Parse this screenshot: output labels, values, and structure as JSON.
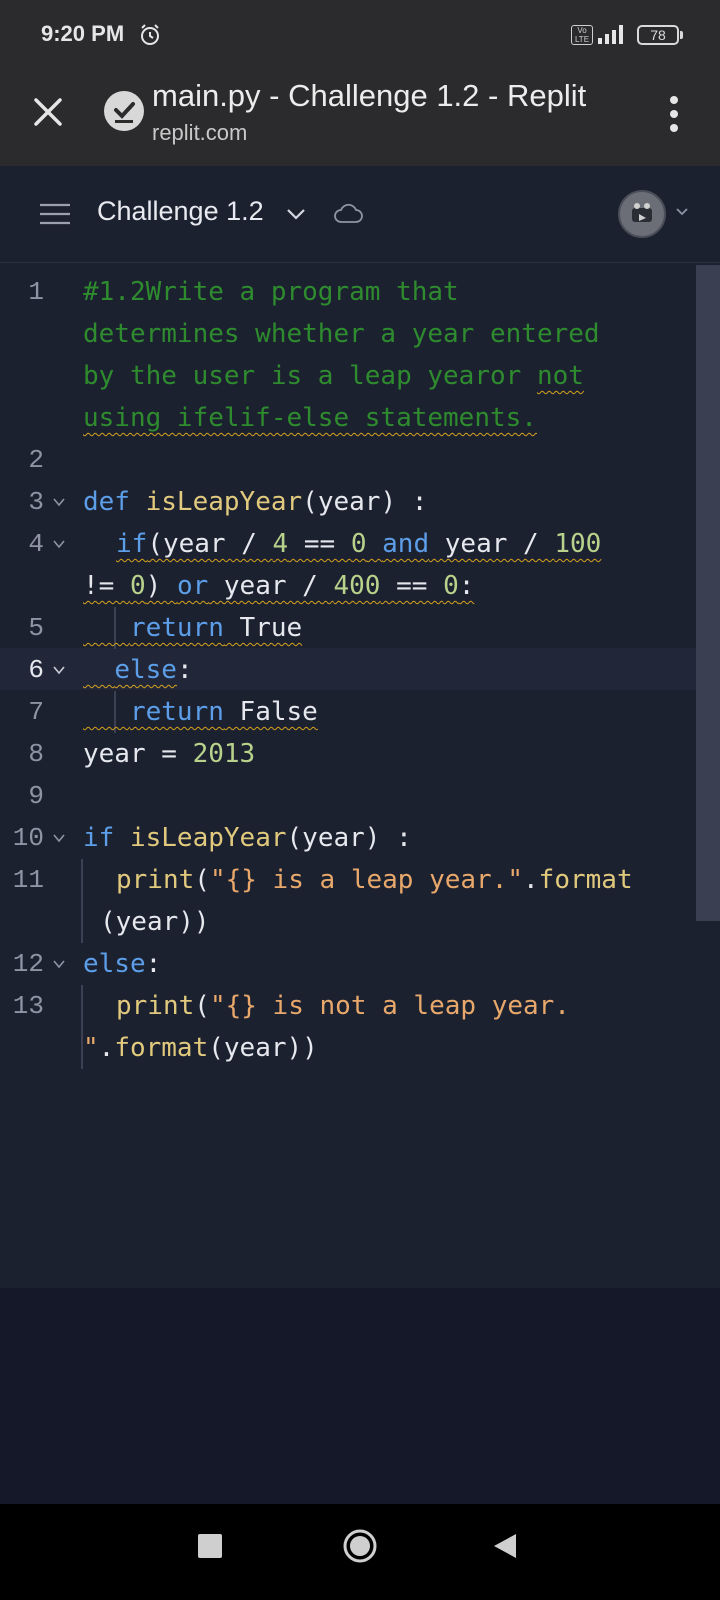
{
  "status_bar": {
    "time": "9:20 PM",
    "volte": "Vo LTE",
    "battery": "78"
  },
  "browser": {
    "tab_title": "main.py - Challenge 1.2 - Replit",
    "url": "replit.com"
  },
  "header": {
    "repl_name": "Challenge 1.2"
  },
  "editor": {
    "line_numbers": [
      "1",
      "2",
      "3",
      "4",
      "5",
      "6",
      "7",
      "8",
      "9",
      "10",
      "11",
      "12",
      "13"
    ],
    "lines": {
      "l1a": "#1.2Write a program that",
      "l1b": "determines whether a year entered",
      "l1c": "by the user is a leap yearor ",
      "l1c_sq": "not",
      "l1d": "using ifelif-else statements.",
      "l3_def": "def",
      "l3_fn": "isLeapYear",
      "l3_rest": "(year) :",
      "l4_if": "if",
      "l4_a": "(year / ",
      "l4_4": "4",
      "l4_b": " == ",
      "l4_0": "0",
      "l4_and": "and",
      "l4_c": " year / ",
      "l4_100": "100",
      "l4b_a": "!= ",
      "l4b_0": "0",
      "l4b_b": ") ",
      "l4b_or": "or",
      "l4b_c": " year / ",
      "l4b_400": "400",
      "l4b_d": " == ",
      "l4b_0b": "0",
      "l4b_e": ":",
      "l5_return": "return",
      "l5_val": " True",
      "l6_else": "else",
      "l6_colon": ":",
      "l7_return": "return",
      "l7_val": " False",
      "l8_a": "year = ",
      "l8_num": "2013",
      "l10_if": "if",
      "l10_fn": "isLeapYear",
      "l10_rest": "(year) :",
      "l11_fn": "print",
      "l11_a": "(",
      "l11_str": "\"{} is a leap year.\"",
      "l11_b": ".",
      "l11_fmt": "format",
      "l11b": "(year))",
      "l12_else": "else",
      "l12_colon": ":",
      "l13_fn": "print",
      "l13_a": "(",
      "l13_str": "\"{} is not a leap year.",
      "l13b_str": "\"",
      "l13b_a": ".",
      "l13b_fmt": "format",
      "l13b_b": "(year))"
    }
  },
  "colors": {
    "editor_bg": "#1c2130",
    "comment": "#2e8b2e",
    "keyword": "#5c9ee8",
    "function": "#e1c97d",
    "string": "#e8a86b",
    "number": "#b8d28b"
  }
}
